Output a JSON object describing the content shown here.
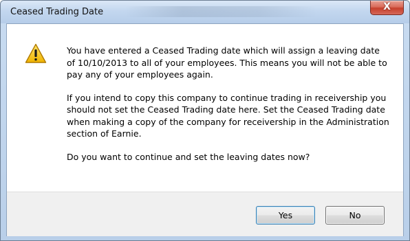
{
  "window": {
    "title": "Ceased Trading Date",
    "close_glyph": "X"
  },
  "dialog": {
    "icon": "warning-icon",
    "paragraphs": [
      "You have entered a Ceased Trading date which will assign a leaving date of 10/10/2013 to all of your employees.  This means you will not be able to pay any of your employees again.",
      "If you intend to copy this company to continue trading in receivership you should not set the Ceased Trading date here.  Set the Ceased Trading date when making a copy of the company for receivership in the Administration section of Earnie.",
      "Do you want to continue and set the leaving dates now?"
    ]
  },
  "buttons": {
    "yes_label": "Yes",
    "no_label": "No"
  },
  "colors": {
    "frame": "#c3d7ef",
    "close": "#c6402c",
    "warning_fill": "#f5c400",
    "footer": "#f0f0f0"
  }
}
